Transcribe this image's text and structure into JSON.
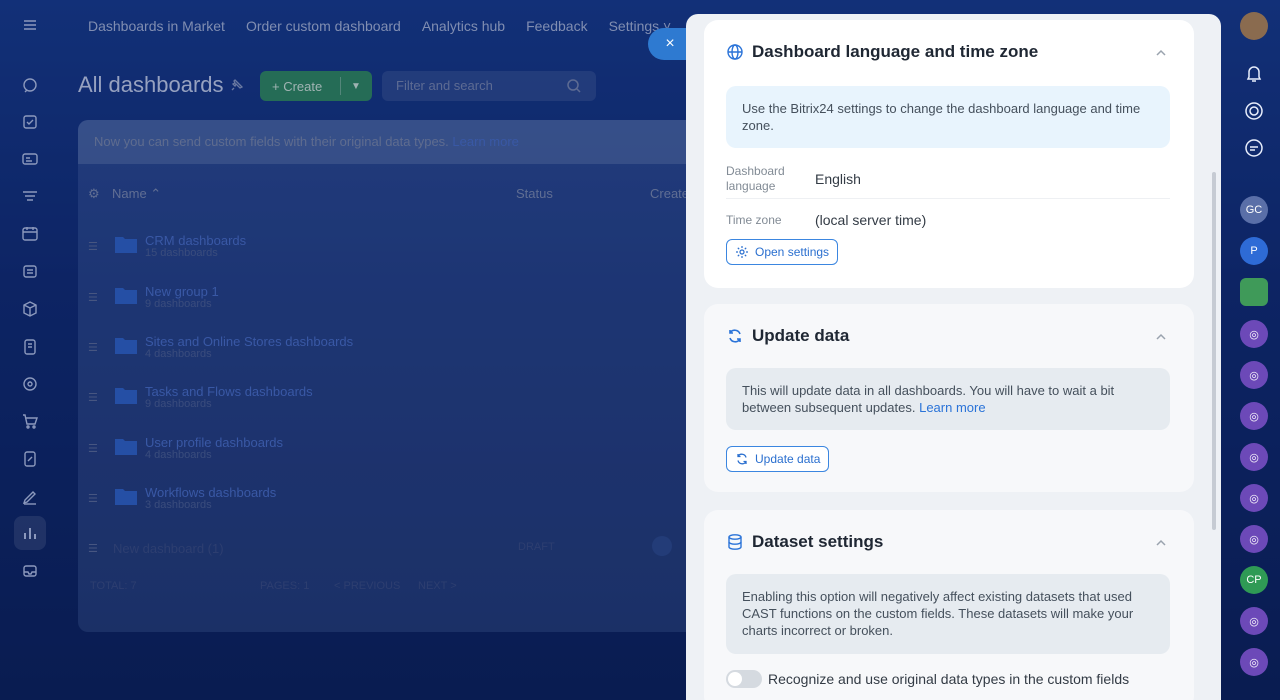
{
  "topnav": {
    "items": [
      "Dashboards in Market",
      "Order custom dashboard",
      "Analytics hub",
      "Feedback",
      "Settings ˅"
    ]
  },
  "page": {
    "title": "All dashboards",
    "create_label": "+ Create",
    "filter_placeholder": "Filter and search"
  },
  "table": {
    "notice": "Now you can send custom fields with their original data types.",
    "notice_link": "Learn more",
    "columns": [
      "Name ⌃",
      "Status",
      "Create"
    ],
    "rows": [
      {
        "name": "CRM dashboards",
        "count": "15 dashboards"
      },
      {
        "name": "New group 1",
        "count": "9 dashboards"
      },
      {
        "name": "Sites and Online Stores dashboards",
        "count": "4 dashboards"
      },
      {
        "name": "Tasks and Flows dashboards",
        "count": "9 dashboards"
      },
      {
        "name": "User profile dashboards",
        "count": "4 dashboards"
      },
      {
        "name": "Workflows dashboards",
        "count": "3 dashboards"
      }
    ],
    "dashboard_row": {
      "name": "New dashboard (1)",
      "status": "DRAFT"
    },
    "footer": {
      "total": "TOTAL: 7",
      "pages": "PAGES: 1",
      "prev": "< PREVIOUS",
      "next": "NEXT >"
    }
  },
  "right_rail": {
    "avatars": [
      "GC",
      "P",
      "CP"
    ]
  },
  "close_label": "×",
  "slider": {
    "language_card": {
      "title": "Dashboard language and time zone",
      "info": "Use the Bitrix24 settings to change the dashboard language and time zone.",
      "language_label": "Dashboard language",
      "language_value": "English",
      "timezone_label": "Time zone",
      "timezone_value": "(local server time)",
      "button": "Open settings"
    },
    "update_card": {
      "title": "Update data",
      "info": "This will update data in all dashboards. You will have to wait a bit between subsequent updates.",
      "info_link": "Learn more",
      "button": "Update data"
    },
    "dataset_card": {
      "title": "Dataset settings",
      "info": "Enabling this option will negatively affect existing datasets that used CAST functions on the custom fields. These datasets will make your charts incorrect or broken.",
      "toggle_label": "Recognize and use original data types in the custom fields",
      "toggle_on": false
    }
  },
  "colors": {
    "accent": "#2a73d8",
    "create_green": "#2f8a5f"
  }
}
